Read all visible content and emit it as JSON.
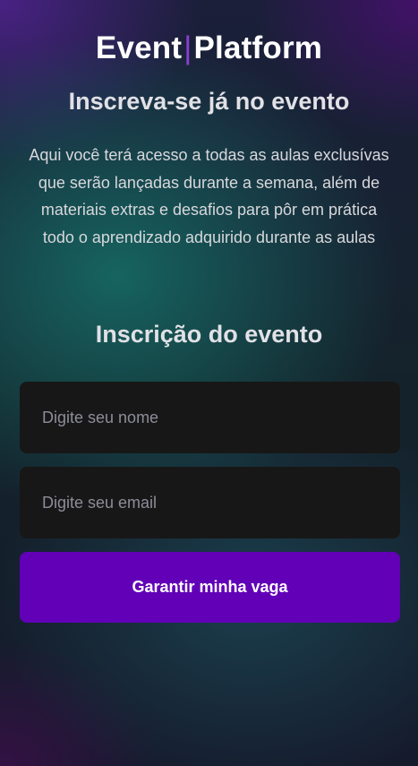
{
  "logo": {
    "part1": "Event",
    "separator": "|",
    "part2": "Platform"
  },
  "hero": {
    "headline": "Inscreva-se já no evento",
    "description": "Aqui você terá acesso a todas as aulas exclusívas que serão lançadas durante a semana, além de materiais extras e desafios para pôr em prática todo o aprendizado adquirido durante as aulas"
  },
  "form": {
    "title": "Inscrição do evento",
    "name_placeholder": "Digite seu nome",
    "email_placeholder": "Digite seu email",
    "submit_label": "Garantir minha vaga"
  },
  "colors": {
    "accent": "#6200b8",
    "logo_separator": "#8a3fd1",
    "input_background": "#171717"
  }
}
